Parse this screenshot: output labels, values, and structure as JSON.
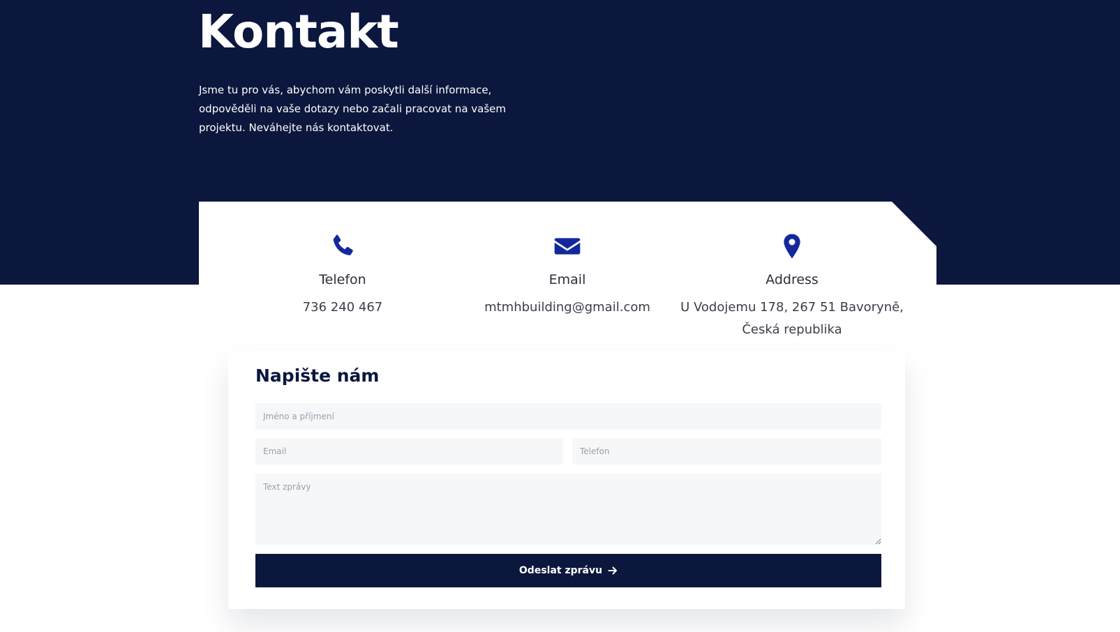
{
  "hero": {
    "title": "Kontakt",
    "text": "Jsme tu pro vás, abychom vám poskytli další informace, odpověděli na vaše dotazy nebo začali pracovat na vašem projektu. Neváhejte nás kontaktovat."
  },
  "contacts": [
    {
      "icon": "phone-icon",
      "label": "Telefon",
      "value": "736 240 467"
    },
    {
      "icon": "envelope-icon",
      "label": "Email",
      "value": "mtmhbuilding@gmail.com"
    },
    {
      "icon": "map-pin-icon",
      "label": "Address",
      "value": "U Vodojemu 178, 267 51 Bavoryně, Česká republika"
    }
  ],
  "form": {
    "title": "Napište nám",
    "name_placeholder": "Jméno a příjmení",
    "email_placeholder": "Email",
    "phone_placeholder": "Telefon",
    "message_placeholder": "Text zprávy",
    "submit_label": "Odeslat zprávu",
    "submit_icon": "arrow-right-icon"
  },
  "colors": {
    "navy": "#0b173d",
    "icon_blue": "#13299b",
    "field_bg": "#f6f7f9"
  }
}
